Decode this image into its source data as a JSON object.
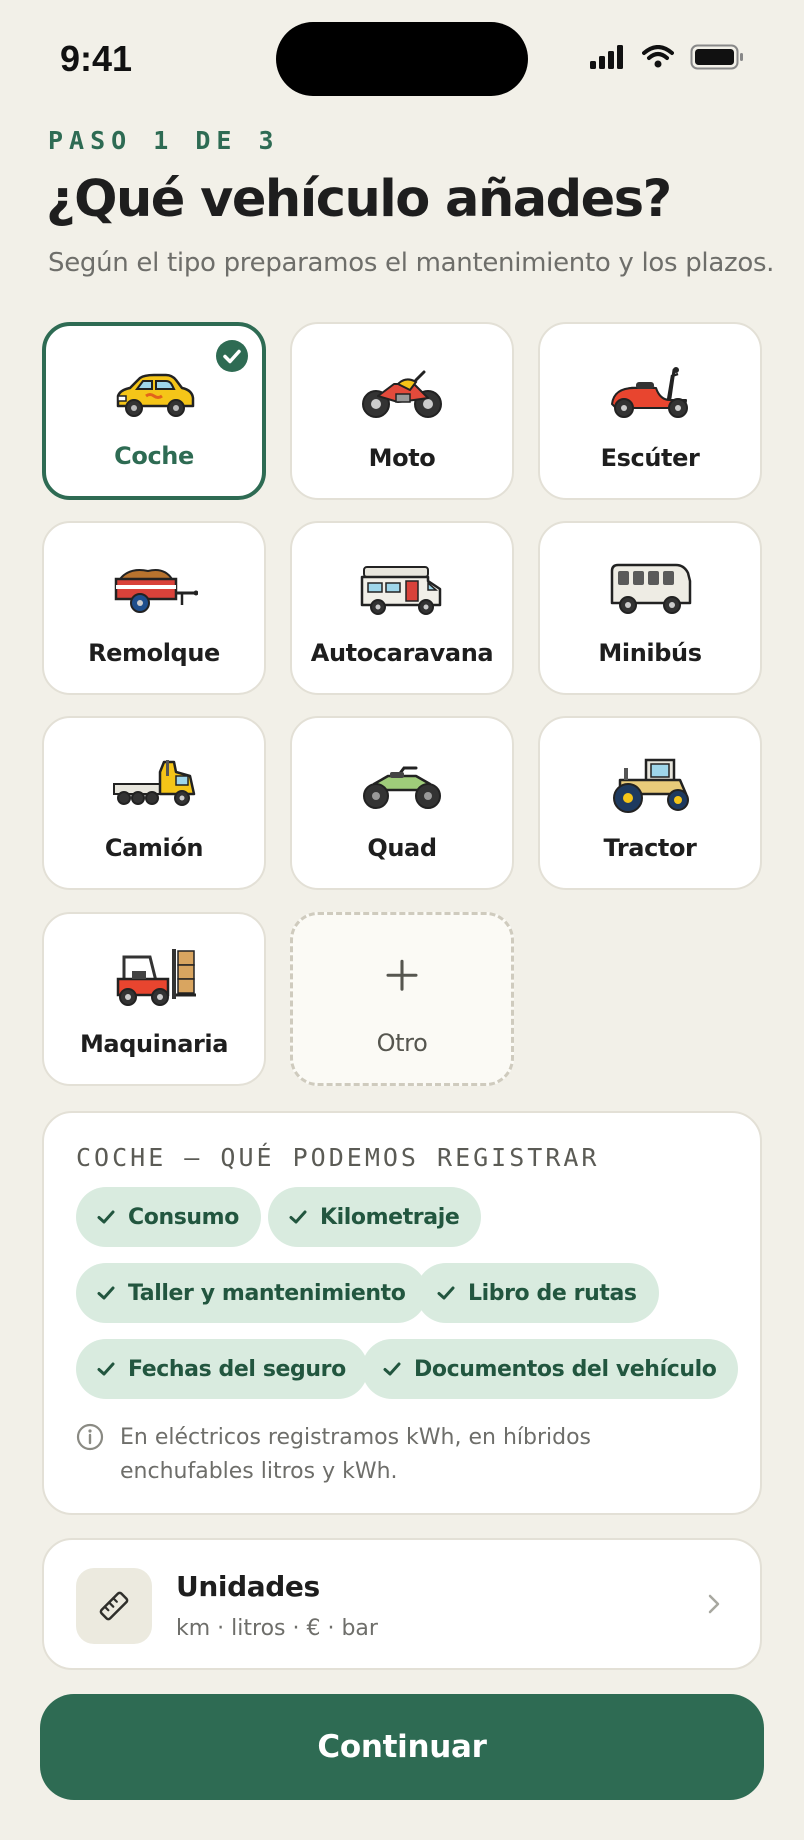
{
  "status_bar": {
    "time": "9:41"
  },
  "header": {
    "step": "PASO 1 DE 3",
    "title": "¿Qué vehículo añades?",
    "subtitle": "Según el tipo preparamos el mantenimiento y los plazos."
  },
  "vehicle_types": [
    {
      "label": "Coche",
      "icon": "car-icon",
      "selected": true
    },
    {
      "label": "Moto",
      "icon": "motorcycle-icon",
      "selected": false
    },
    {
      "label": "Escúter",
      "icon": "scooter-icon",
      "selected": false
    },
    {
      "label": "Remolque",
      "icon": "trailer-icon",
      "selected": false
    },
    {
      "label": "Autocaravana",
      "icon": "motorhome-icon",
      "selected": false
    },
    {
      "label": "Minibús",
      "icon": "minibus-icon",
      "selected": false
    },
    {
      "label": "Camión",
      "icon": "truck-icon",
      "selected": false
    },
    {
      "label": "Quad",
      "icon": "quad-icon",
      "selected": false
    },
    {
      "label": "Tractor",
      "icon": "tractor-icon",
      "selected": false
    },
    {
      "label": "Maquinaria",
      "icon": "forklift-icon",
      "selected": false
    },
    {
      "label": "Otro",
      "icon": "plus-icon",
      "selected": false
    }
  ],
  "features": {
    "title": "COCHE — QUÉ PODEMOS REGISTRAR",
    "chips": [
      "Consumo",
      "Kilometraje",
      "Taller y mantenimiento",
      "Libro de rutas",
      "Fechas del seguro",
      "Documentos del vehículo"
    ],
    "note": "En eléctricos registramos kWh, en híbridos enchufables litros y kWh."
  },
  "units": {
    "title": "Unidades",
    "subtitle": "km · litros · € · bar"
  },
  "continue_label": "Continuar",
  "colors": {
    "accent": "#2E6B53",
    "background": "#F2F0E8",
    "chip_bg": "#D9EBDF"
  }
}
